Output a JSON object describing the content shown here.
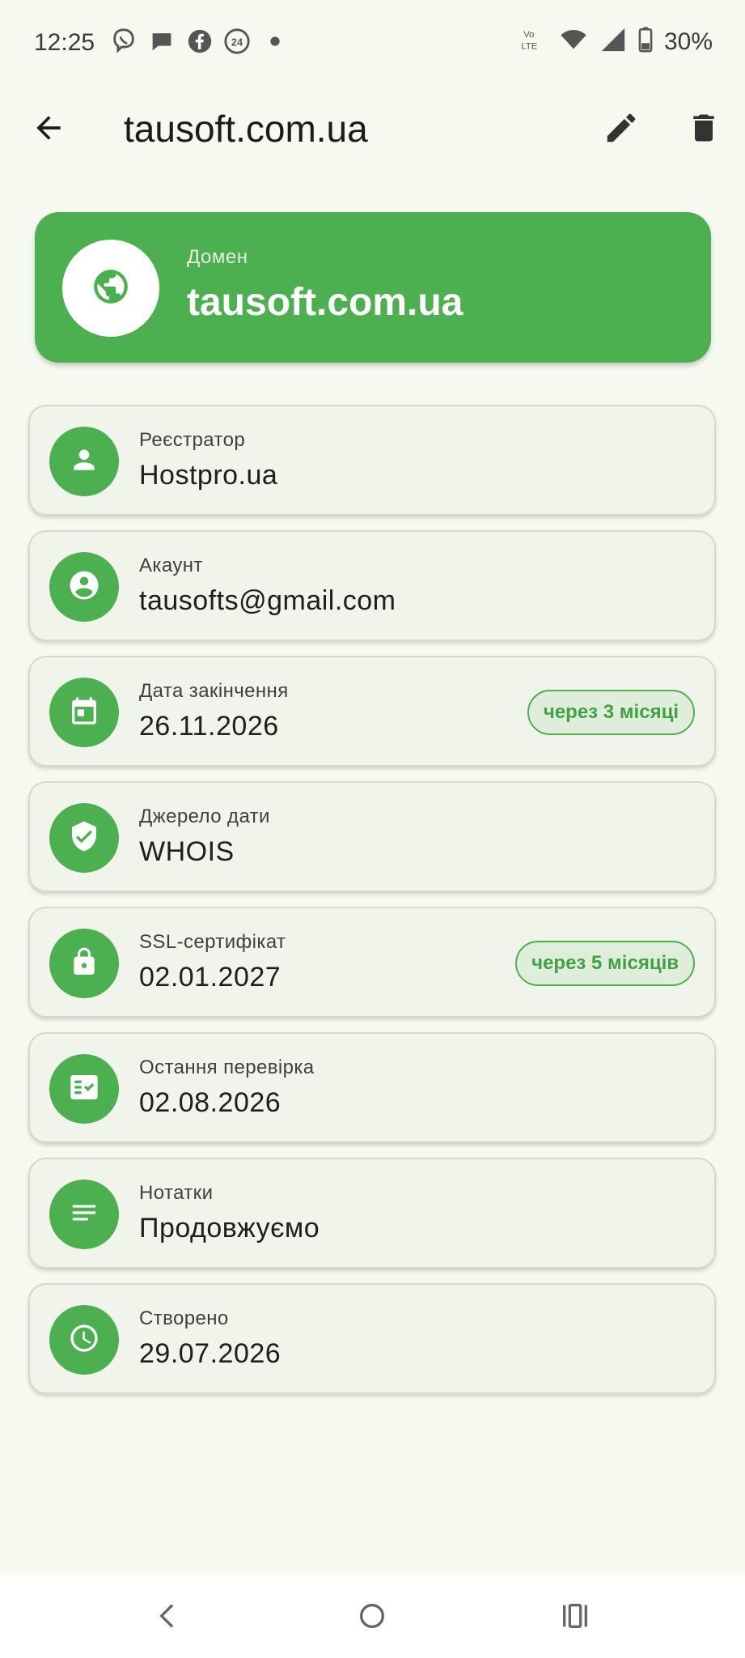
{
  "status_bar": {
    "time": "12:25",
    "battery": "30%",
    "icons": [
      "viber-icon",
      "message-icon",
      "facebook-icon",
      "24-icon",
      "dot-icon",
      "volte-icon",
      "wifi-icon",
      "signal-icon",
      "battery-icon"
    ]
  },
  "app_bar": {
    "title": "tausoft.com.ua",
    "icons": [
      "arrow-back-icon",
      "edit-icon",
      "delete-icon"
    ]
  },
  "header": {
    "label": "Домен",
    "value": "tausoft.com.ua",
    "icon": "globe-icon"
  },
  "items": [
    {
      "label": "Реєстратор",
      "value": "Hostpro.ua",
      "icon": "person-icon",
      "badge": ""
    },
    {
      "label": "Акаунт",
      "value": "tausofts@gmail.com",
      "icon": "account-circle-icon",
      "badge": ""
    },
    {
      "label": "Дата закінчення",
      "value": "26.11.2026",
      "icon": "calendar-icon",
      "badge": "через 3 місяці"
    },
    {
      "label": "Джерело дати",
      "value": "WHOIS",
      "icon": "verified-shield-icon",
      "badge": ""
    },
    {
      "label": "SSL-сертифікат",
      "value": "02.01.2027",
      "icon": "lock-icon",
      "badge": "через 5 місяців"
    },
    {
      "label": "Остання перевірка",
      "value": "02.08.2026",
      "icon": "fact-check-icon",
      "badge": ""
    },
    {
      "label": "Нотатки",
      "value": "Продовжуємо",
      "icon": "notes-icon",
      "badge": ""
    },
    {
      "label": "Створено",
      "value": "29.07.2026",
      "icon": "clock-icon",
      "badge": ""
    }
  ],
  "colors": {
    "accent": "#4caf50",
    "background": "#f6f9f0",
    "card": "#f1f4ea",
    "badge_bg": "#dfeedb"
  }
}
